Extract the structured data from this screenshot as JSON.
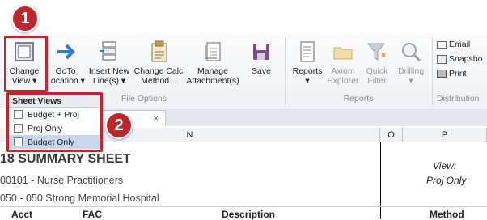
{
  "ribbon": {
    "buttons": [
      {
        "id": "change-view",
        "label1": "Change",
        "label2": "View ▾"
      },
      {
        "id": "goto-location",
        "label1": "GoTo",
        "label2": "Location ▾"
      },
      {
        "id": "insert-new-lines",
        "label1": "Insert New",
        "label2": "Line(s) ▾"
      },
      {
        "id": "change-calc-method",
        "label1": "Change Calc",
        "label2": "Method..."
      },
      {
        "id": "manage-attachments",
        "label1": "Manage",
        "label2": "Attachment(s)"
      },
      {
        "id": "save",
        "label1": "Save",
        "label2": ""
      },
      {
        "id": "reports",
        "label1": "Reports",
        "label2": "▾"
      },
      {
        "id": "axiom-explorer",
        "label1": "Axiom",
        "label2": "Explorer"
      },
      {
        "id": "quick-filter",
        "label1": "Quick",
        "label2": "Filter"
      },
      {
        "id": "drilling",
        "label1": "Drilling",
        "label2": "▾"
      }
    ],
    "small_buttons": [
      "Email",
      "Snapsho",
      "Print"
    ],
    "groups": [
      "File Options",
      "Reports",
      "Distribution"
    ]
  },
  "dropdown": {
    "title": "Sheet Views",
    "items": [
      "Budget + Proj",
      "Proj Only",
      "Budget Only"
    ],
    "selected_index": 2
  },
  "tab": {
    "close": "×"
  },
  "badges": [
    "1",
    "2"
  ],
  "columns": [
    "N",
    "O",
    "P"
  ],
  "sheet": {
    "title": "18 SUMMARY SHEET",
    "line1": "00101 - Nurse Practitioners",
    "line2": "050 - 050 Strong Memorial Hospital",
    "view_label": "View:",
    "view_value": "Proj Only",
    "headers": [
      "Acct",
      "FAC",
      "Description",
      "Method"
    ]
  },
  "colors": {
    "highlight": "#c0272d",
    "accent": "#2f7bd6"
  }
}
